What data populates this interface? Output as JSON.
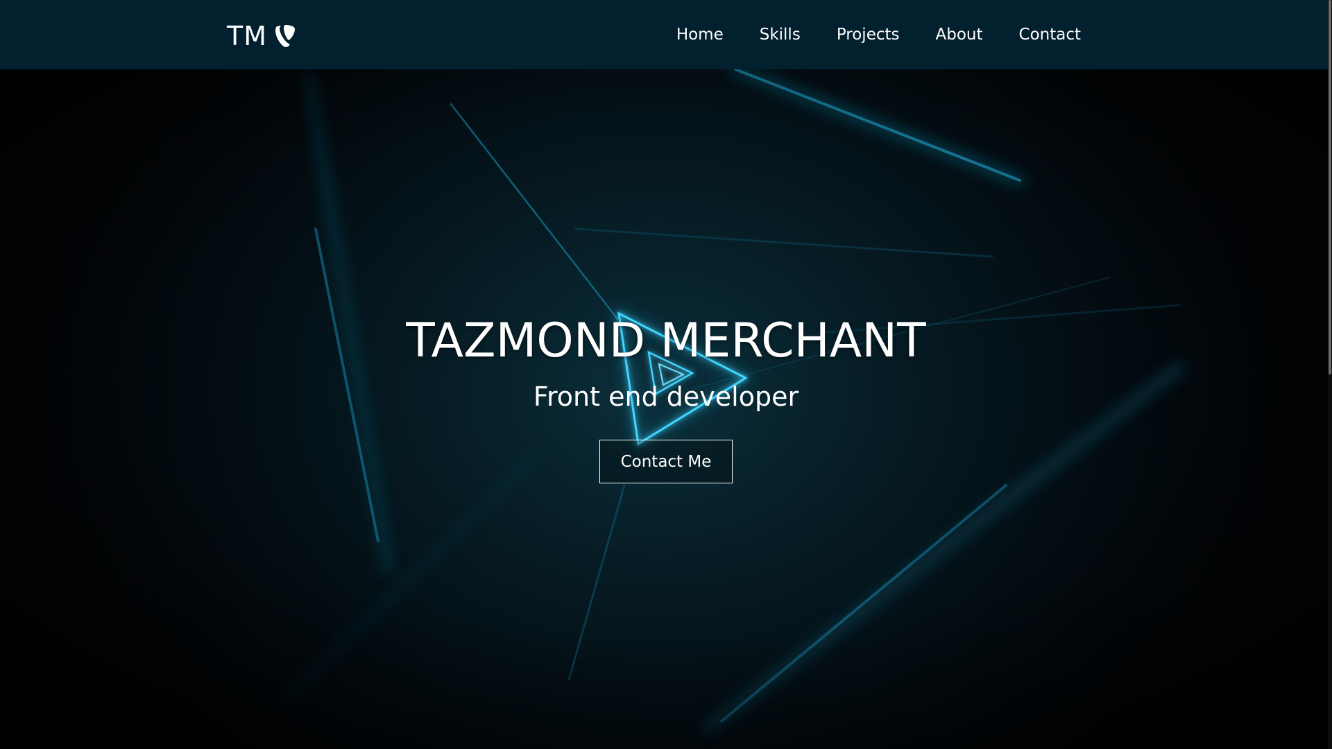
{
  "brand": {
    "text": "TM",
    "icon": "typo3-logo-icon"
  },
  "nav": {
    "items": [
      {
        "label": "Home"
      },
      {
        "label": "Skills"
      },
      {
        "label": "Projects"
      },
      {
        "label": "About"
      },
      {
        "label": "Contact"
      }
    ]
  },
  "hero": {
    "title": "TAZMOND MERCHANT",
    "subtitle": "Front end developer",
    "cta_label": "Contact Me"
  },
  "colors": {
    "navbar_bg": "#02202e",
    "accent": "#1fb6e0",
    "text": "#ffffff"
  }
}
